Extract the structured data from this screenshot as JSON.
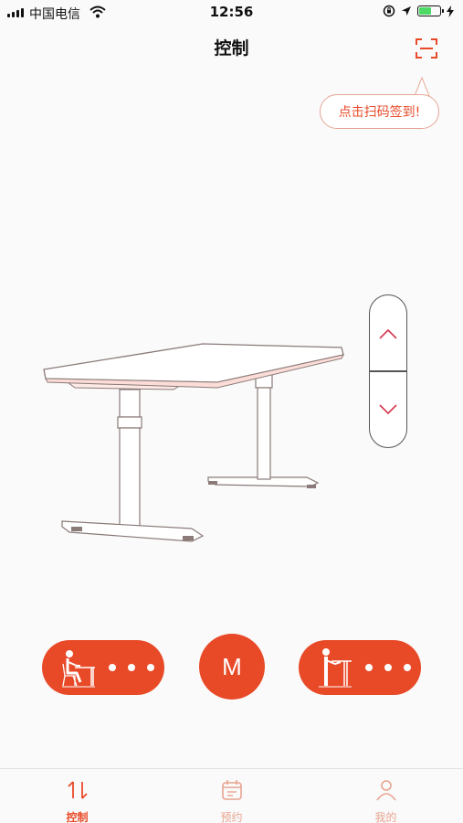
{
  "status_bar": {
    "carrier": "中国电信",
    "time": "12:56",
    "battery_level": 0.6
  },
  "header": {
    "title": "控制",
    "scan_icon": "scan-icon"
  },
  "tooltip": {
    "text": "点击扫码签到!"
  },
  "desk_control": {
    "up_icon": "chevron-up-icon",
    "down_icon": "chevron-down-icon"
  },
  "presets": {
    "sit_icon": "sitting-person-icon",
    "stand_icon": "standing-person-icon",
    "memory_label": "M"
  },
  "tabs": [
    {
      "label": "控制",
      "icon": "updown-arrows-icon",
      "active": true
    },
    {
      "label": "预约",
      "icon": "calendar-icon",
      "active": false
    },
    {
      "label": "我的",
      "icon": "person-icon",
      "active": false
    }
  ],
  "colors": {
    "accent": "#e84a28",
    "accent_light": "#e8a48f",
    "tooltip_border": "#e4a795"
  }
}
